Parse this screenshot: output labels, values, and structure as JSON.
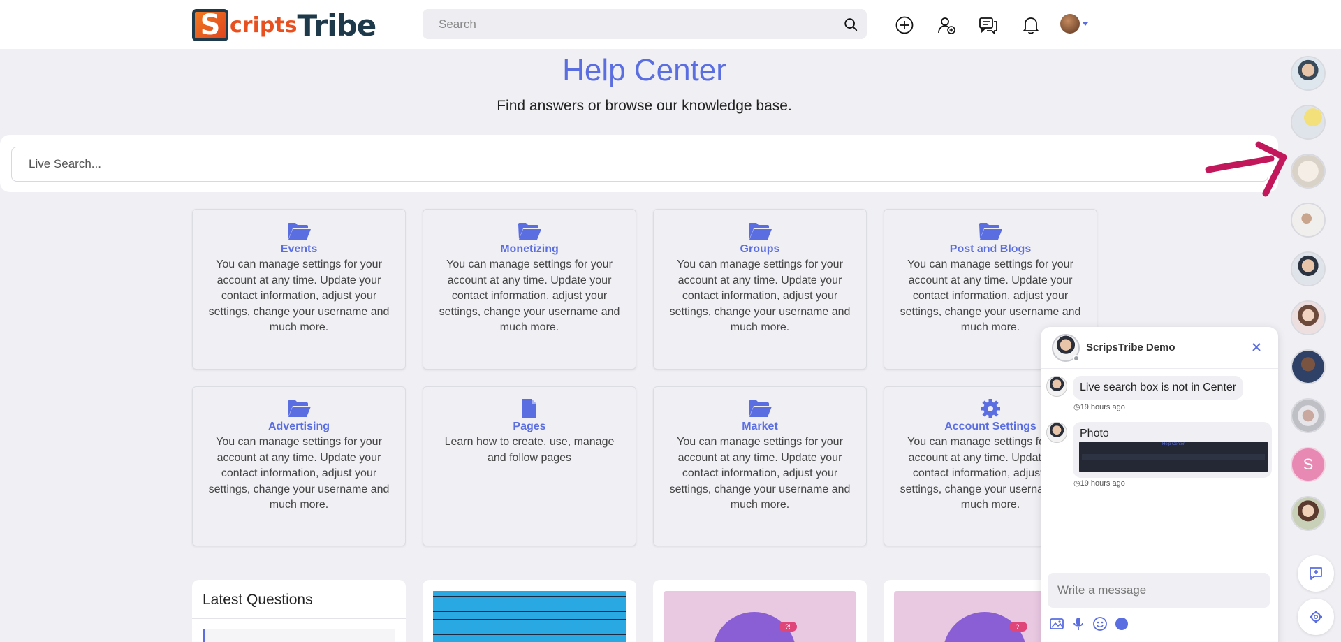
{
  "header": {
    "logo_text_first": "S",
    "logo_text_second": "cripts",
    "logo_text_third": "Tribe",
    "search_placeholder": "Search",
    "icons": [
      "add-circle-icon",
      "add-user-icon",
      "messages-icon",
      "bell-icon",
      "user-avatar",
      "chevron-down-icon"
    ]
  },
  "hero": {
    "title": "Help Center",
    "subtitle": "Find answers or browse our knowledge base.",
    "live_search_placeholder": "Live Search..."
  },
  "categories": [
    {
      "title": "Events",
      "icon": "folder-open-icon",
      "desc": "You can manage settings for your account at any time. Update your contact information, adjust your settings, change your username and much more."
    },
    {
      "title": "Monetizing",
      "icon": "folder-open-icon",
      "desc": "You can manage settings for your account at any time. Update your contact information, adjust your settings, change your username and much more."
    },
    {
      "title": "Groups",
      "icon": "folder-open-icon",
      "desc": "You can manage settings for your account at any time. Update your contact information, adjust your settings, change your username and much more."
    },
    {
      "title": "Post and Blogs",
      "icon": "folder-open-icon",
      "desc": "You can manage settings for your account at any time. Update your contact information, adjust your settings, change your username and much more."
    },
    {
      "title": "Advertising",
      "icon": "folder-open-icon",
      "desc": "You can manage settings for your account at any time. Update your contact information, adjust your settings, change your username and much more."
    },
    {
      "title": "Pages",
      "icon": "file-icon",
      "desc": "Learn how to create, use, manage and follow pages"
    },
    {
      "title": "Market",
      "icon": "folder-open-icon",
      "desc": "You can manage settings for your account at any time. Update your contact information, adjust your settings, change your username and much more."
    },
    {
      "title": "Account Settings",
      "icon": "gear-icon",
      "desc": "You can manage settings for your account at any time. Update your contact information, adjust your settings, change your username and much more."
    }
  ],
  "latest_questions": {
    "title": "Latest Questions"
  },
  "chat": {
    "name": "ScripsTribe Demo",
    "messages": [
      {
        "text": "Live search box is not in Center",
        "time": "19 hours ago"
      },
      {
        "text": "Photo",
        "time": "19 hours ago"
      }
    ],
    "photo_preview_title": "Help Center",
    "input_placeholder": "Write a message",
    "tools": [
      "image-icon",
      "microphone-icon",
      "emoji-icon",
      "dot-icon"
    ]
  },
  "rail": {
    "letter_avatar": "S",
    "buttons": [
      "new-chat-icon",
      "settings-icon"
    ]
  },
  "colors": {
    "accent": "#5b6ee1",
    "background": "#f0f0f4",
    "annotation": "#c2185b",
    "logo_orange": "#e8501f",
    "logo_navy": "#1e3a4a"
  }
}
